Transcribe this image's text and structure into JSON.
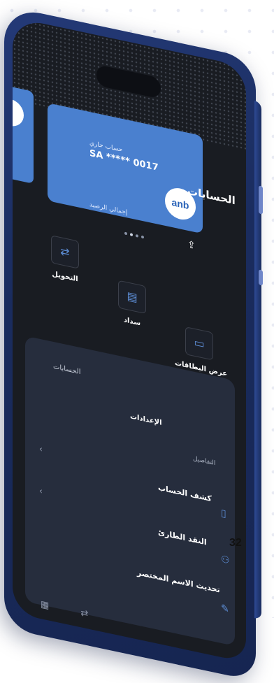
{
  "header": {
    "title": "الحسابات"
  },
  "card": {
    "account_type": "حساب جاري",
    "iban_masked": "SA ***** 0017",
    "total_balance_label": "إجمالي الرصيد",
    "logo_text": "anb"
  },
  "pager": {
    "count": 4,
    "active_index": 1
  },
  "quick_actions": [
    {
      "label": "التحويل",
      "icon": "transfer-icon"
    },
    {
      "label": "سداد",
      "icon": "bill-pay-icon"
    },
    {
      "label": "عرض البطاقات",
      "icon": "card-icon"
    }
  ],
  "tabs": [
    {
      "label": "الحسابات"
    },
    {
      "label": "الإعدادات",
      "active": true
    }
  ],
  "section_label": "التفاصيل",
  "rows": [
    {
      "label": "كشف الحساب",
      "icon": "statement-icon"
    },
    {
      "label": "النقد الطارئ",
      "icon": "emergency-cash-icon"
    },
    {
      "label": "تحديث الاسم المختصر",
      "icon": "edit-icon"
    }
  ],
  "page_number": "32",
  "colors": {
    "card_blue": "#4a80cf",
    "phone_frame": "#1a2c5e",
    "screen_bg": "#191c22",
    "accent_icon": "#5e8fd8"
  }
}
